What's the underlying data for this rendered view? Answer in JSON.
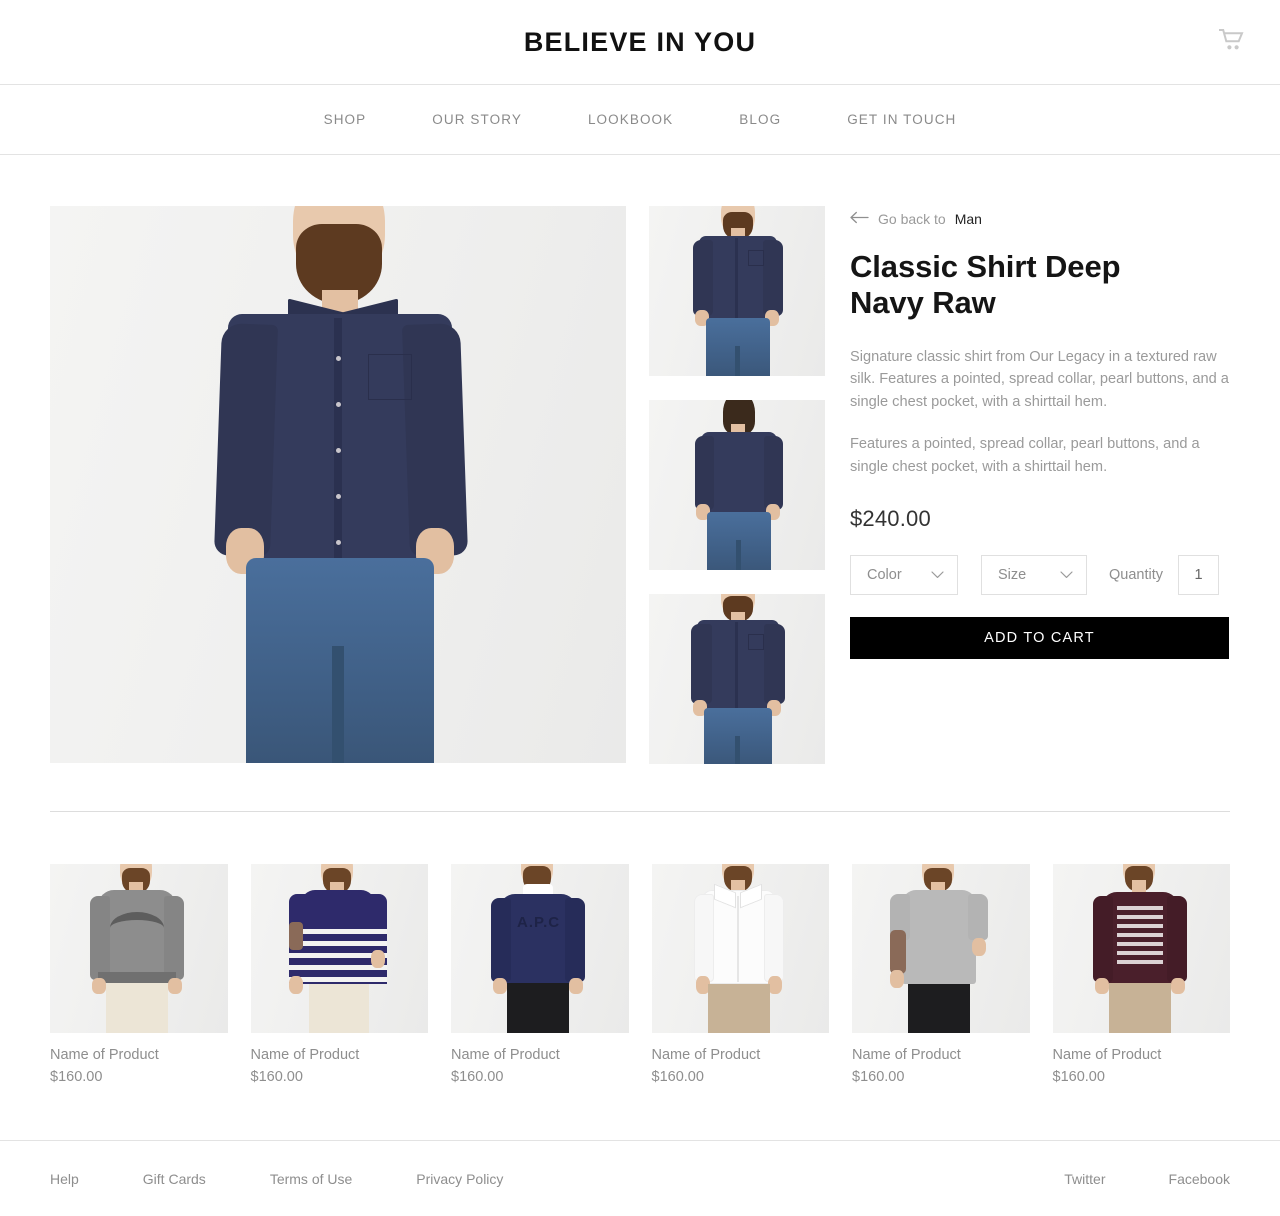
{
  "header": {
    "brand": "BELIEVE IN YOU",
    "cart_icon": "shopping-cart-icon"
  },
  "nav": {
    "items": [
      {
        "label": "SHOP"
      },
      {
        "label": "OUR STORY"
      },
      {
        "label": "LOOKBOOK"
      },
      {
        "label": "BLOG"
      },
      {
        "label": "GET IN TOUCH"
      }
    ]
  },
  "product": {
    "back_link": {
      "arrow_icon": "arrow-left-icon",
      "prefix": "Go back to",
      "category": "Man"
    },
    "title": "Classic Shirt Deep Navy Raw",
    "description_1": "Signature classic shirt from Our Legacy in a textured raw silk. Features a pointed, spread collar, pearl buttons, and a single chest pocket, with a shirttail hem.",
    "description_2": "Features a pointed, spread collar, pearl buttons, and a single chest pocket, with a shirttail hem.",
    "price": "$240.00",
    "options": {
      "color": {
        "label": "Color",
        "chevron_icon": "chevron-down-icon"
      },
      "size": {
        "label": "Size",
        "chevron_icon": "chevron-down-icon"
      },
      "quantity": {
        "label": "Quantity",
        "value": "1"
      }
    },
    "add_to_cart": "ADD TO CART",
    "main_image_alt": "Man wearing deep navy classic shirt with blue jeans",
    "thumbnails": [
      {
        "alt": "Navy shirt front view"
      },
      {
        "alt": "Navy shirt back view"
      },
      {
        "alt": "Navy shirt full front view"
      }
    ]
  },
  "related": {
    "items": [
      {
        "name": "Name of Product",
        "price": "$160.00",
        "alt": "Gray Kobenhavn sweatshirt"
      },
      {
        "name": "Name of Product",
        "price": "$160.00",
        "alt": "Navy striped t-shirt"
      },
      {
        "name": "Name of Product",
        "price": "$160.00",
        "alt": "Navy APC sweatshirt"
      },
      {
        "name": "Name of Product",
        "price": "$160.00",
        "alt": "White oxford shirt"
      },
      {
        "name": "Name of Product",
        "price": "$160.00",
        "alt": "Gray t-shirt"
      },
      {
        "name": "Name of Product",
        "price": "$160.00",
        "alt": "Burgundy alphabet sweatshirt"
      }
    ]
  },
  "footer": {
    "left_links": [
      {
        "label": "Help"
      },
      {
        "label": "Gift Cards"
      },
      {
        "label": "Terms of Use"
      },
      {
        "label": "Privacy Policy"
      }
    ],
    "right_links": [
      {
        "label": "Twitter"
      },
      {
        "label": "Facebook"
      }
    ]
  },
  "colors": {
    "accent": "#000000",
    "text_muted": "#8e8e8e",
    "garment_navy": "#343b5c",
    "photo_bg": "#f2f2f1"
  }
}
